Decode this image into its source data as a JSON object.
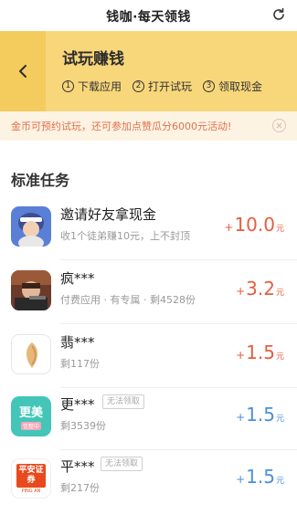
{
  "nav": {
    "title": "钱咖·每天领钱",
    "refresh_icon": "refresh-icon"
  },
  "header": {
    "back_icon": "chevron-left-icon",
    "title": "试玩赚钱",
    "steps": [
      {
        "num": "1",
        "label": "下载应用"
      },
      {
        "num": "2",
        "label": "打开试玩"
      },
      {
        "num": "3",
        "label": "领取现金"
      }
    ],
    "color": "#f8d77b"
  },
  "notice": {
    "text": "金币可预约试玩，还可参加点赞瓜分6000元活动!",
    "close_icon": "close-icon"
  },
  "section": {
    "title": "标准任务"
  },
  "tasks": [
    {
      "name": "邀请好友拿现金",
      "sub": "收1个徒弟赚10元，上不封顶",
      "plus": "+",
      "amount": "10.0",
      "unit": "元",
      "color": "#e55d3f"
    },
    {
      "name": "疯***",
      "sub": "付费应用 · 有专属 · 剩4528份",
      "plus": "+",
      "amount": "3.2",
      "unit": "元",
      "color": "#e55d3f"
    },
    {
      "name": "翡***",
      "sub": "剩117份",
      "plus": "+",
      "amount": "1.5",
      "unit": "元",
      "color": "#e55d3f"
    },
    {
      "name": "更***",
      "badge": "无法领取",
      "sub": "剩3539份",
      "icon_text": "更美",
      "icon_subtext": "信整中",
      "plus": "+",
      "amount": "1.5",
      "unit": "元",
      "color": "#4b8ee0"
    },
    {
      "name": "平***",
      "badge": "无法领取",
      "sub": "剩217份",
      "icon_text": "平安证券",
      "icon_subtext": "PING AN",
      "plus": "+",
      "amount": "1.5",
      "unit": "元",
      "color": "#4b8ee0"
    }
  ]
}
